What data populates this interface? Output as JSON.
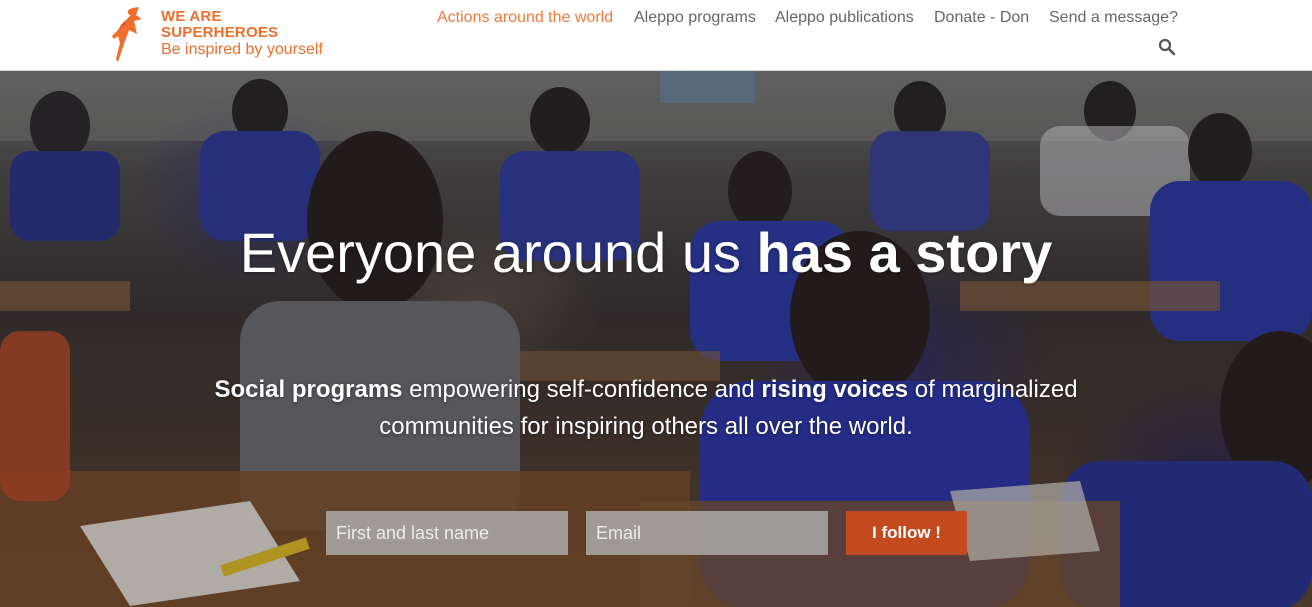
{
  "header": {
    "logo": {
      "line1": "WE ARE",
      "line2": "SUPERHEROES",
      "tagline": "Be inspired by yourself",
      "icon": "superhero-figure-icon"
    },
    "nav": [
      {
        "label": "Actions around the world",
        "active": true
      },
      {
        "label": "Aleppo programs",
        "active": false
      },
      {
        "label": "Aleppo publications",
        "active": false
      },
      {
        "label": "Donate - Don",
        "active": false
      },
      {
        "label": "Send a message?",
        "active": false
      }
    ],
    "search_icon": "search-icon"
  },
  "hero": {
    "title_regular": "Everyone around us ",
    "title_bold": "has a story",
    "subtitle": {
      "bold1": "Social programs",
      "text1": " empowering self-confidence and ",
      "bold2": "rising voices",
      "text2": " of marginalized communities for inspiring others all over the world."
    },
    "form": {
      "name_placeholder": "First and last name",
      "email_placeholder": "Email",
      "button_label": "I follow !"
    }
  },
  "colors": {
    "brand_orange": "#ee6e2c",
    "nav_text": "#666666",
    "button_bg": "#c24a1e"
  }
}
